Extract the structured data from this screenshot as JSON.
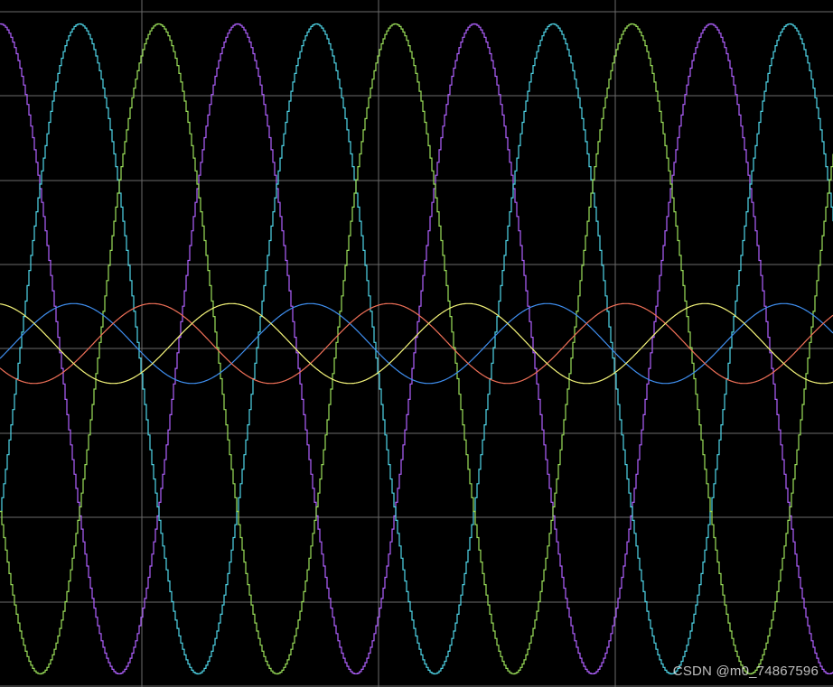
{
  "watermark": "CSDN @m0_74867596",
  "colors": {
    "background": "#000000",
    "grid": "#6b6b6b"
  },
  "chart_data": {
    "type": "line",
    "title": "",
    "xlabel": "",
    "ylabel": "",
    "grid": true,
    "grid_divisions": {
      "x": 3.5,
      "y": 8
    },
    "xlim": [
      0,
      922
    ],
    "ylim": [
      -1.0,
      1.0
    ],
    "series": [
      {
        "color": "#b061ff",
        "amplitude": 0.96,
        "offset": 0.0,
        "period": 262,
        "phase_deg": 90,
        "stepped": true
      },
      {
        "color": "#4fd6e8",
        "amplitude": 0.96,
        "offset": 0.0,
        "period": 262,
        "phase_deg": -30,
        "stepped": true
      },
      {
        "color": "#9be05a",
        "amplitude": 0.96,
        "offset": 0.0,
        "period": 262,
        "phase_deg": 210,
        "stepped": true
      },
      {
        "color": "#3f8ff0",
        "amplitude": 0.118,
        "offset": 0.016,
        "period": 262,
        "phase_deg": -22,
        "stepped": false
      },
      {
        "color": "#f07058",
        "amplitude": 0.118,
        "offset": 0.016,
        "period": 262,
        "phase_deg": -142,
        "stepped": false
      },
      {
        "color": "#f5f57a",
        "amplitude": 0.118,
        "offset": 0.016,
        "period": 262,
        "phase_deg": 98,
        "stepped": false
      }
    ]
  }
}
